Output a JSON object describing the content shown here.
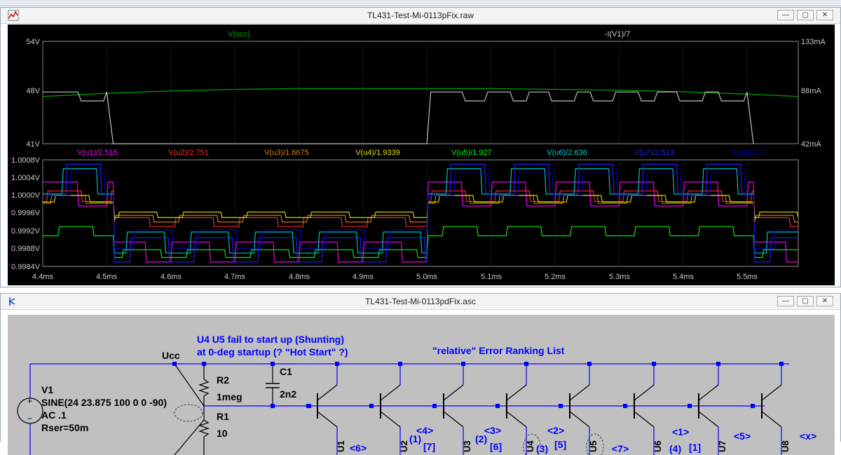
{
  "waveform_window": {
    "title": "TL431-Test-Mi-0113pFix.raw",
    "controls": {
      "minimize": "—",
      "maximize": "▢",
      "close": "✕"
    }
  },
  "schematic_window": {
    "title": "TL431-Test-Mi-0113pdFix.asc",
    "controls": {
      "minimize": "—",
      "maximize": "▢",
      "close": "✕"
    }
  },
  "chart_data": [
    {
      "type": "line",
      "title": "",
      "left_trace_label": "V(ucc)",
      "right_trace_label": "-I(V1)/7",
      "left_axis_ticks": [
        "54V",
        "48V",
        "41V"
      ],
      "right_axis_ticks": [
        "133mA",
        "88mA",
        "42mA"
      ],
      "ylim_left": [
        41,
        54
      ],
      "ylim_right": [
        42,
        133
      ],
      "xlim_ms": [
        4.4,
        5.58
      ],
      "series": [
        {
          "name": "V(ucc)",
          "color": "#00a000",
          "x": [
            4.4,
            4.5,
            4.6,
            4.7,
            4.8,
            4.9,
            5.0,
            5.1,
            5.2,
            5.3,
            5.4,
            5.5,
            5.58
          ],
          "y": [
            47.0,
            47.4,
            47.7,
            47.9,
            48.0,
            48.0,
            48.0,
            48.0,
            47.9,
            47.8,
            47.6,
            47.3,
            47.0
          ]
        },
        {
          "name": "-I(V1)/7",
          "color": "#c0c0c0",
          "x": [
            4.4,
            4.455,
            4.46,
            4.495,
            4.5,
            4.51,
            5.0,
            5.006,
            5.055,
            5.06,
            5.09,
            5.095,
            5.13,
            5.135,
            5.155,
            5.16,
            5.19,
            5.195,
            5.23,
            5.235,
            5.255,
            5.26,
            5.29,
            5.295,
            5.33,
            5.335,
            5.355,
            5.36,
            5.39,
            5.395,
            5.43,
            5.435,
            5.455,
            5.46,
            5.495,
            5.5,
            5.51
          ],
          "y": [
            88,
            88,
            80,
            80,
            88,
            42,
            42,
            88,
            88,
            80,
            80,
            88,
            88,
            80,
            80,
            88,
            88,
            80,
            80,
            88,
            88,
            80,
            80,
            88,
            88,
            80,
            80,
            88,
            88,
            80,
            80,
            88,
            88,
            80,
            80,
            88,
            42
          ]
        }
      ]
    },
    {
      "type": "line",
      "title": "",
      "y_axis_ticks": [
        "1.0008V",
        "1.0004V",
        "1.0000V",
        "0.9996V",
        "0.9992V",
        "0.9988V",
        "0.9984V"
      ],
      "ylim": [
        0.9984,
        1.0008
      ],
      "x_axis_ticks": [
        "4.4ms",
        "4.5ms",
        "4.6ms",
        "4.7ms",
        "4.8ms",
        "4.9ms",
        "5.0ms",
        "5.1ms",
        "5.2ms",
        "5.3ms",
        "5.4ms",
        "5.5ms"
      ],
      "xlim_ms": [
        4.4,
        5.58
      ],
      "series": [
        {
          "name": "V(u1)/2.515",
          "color": "#ff00ff",
          "high": 1.0003,
          "low": 0.9985
        },
        {
          "name": "V(u2)/2.751",
          "color": "#ff3030",
          "high": 1.0001,
          "low": 0.9993
        },
        {
          "name": "V(u3)/1.6675",
          "color": "#e08000",
          "high": 1.0,
          "low": 0.9994
        },
        {
          "name": "V(u4)/1.9339",
          "color": "#e0e000",
          "high": 1.0,
          "low": 0.9995
        },
        {
          "name": "V(u5)/1.927",
          "color": "#00ff00",
          "high": 0.9993,
          "low": 0.9986
        },
        {
          "name": "V(u6)/2.636",
          "color": "#00d0d0",
          "high": 1.0006,
          "low": 0.9987
        },
        {
          "name": "V(u7)/2.513",
          "color": "#2020ff",
          "high": 1.0007,
          "low": 0.9985
        },
        {
          "name": "V(u8)/2.5",
          "color": "#0000c0",
          "high": 1.0005,
          "low": 0.9988
        }
      ],
      "active_intervals_ms": [
        [
          4.4,
          4.51
        ],
        [
          5.0,
          5.51
        ]
      ],
      "toggle_period_ms": 0.1
    }
  ],
  "schematic": {
    "notes": [
      "U4 U5 fail to start up (Shunting)",
      "at 0-deg startup (? \"Hot Start\" ?)",
      "\"relative\" Error Ranking List"
    ],
    "labels": {
      "ucc": "Ucc",
      "v1": "V1",
      "v1_value": "SINE(24 23.875 100 0 0 -90)",
      "v1_ac": "AC .1",
      "v1_rser": "Rser=50m",
      "r2": "R2",
      "r2_value": "1meg",
      "r1": "R1",
      "r1_value": "10",
      "c1": "C1",
      "c1_value": "2n2",
      "plus": "+",
      "minus": "−"
    },
    "transistor_labels": [
      "U1",
      "U2",
      "U3",
      "U4",
      "U5",
      "U6",
      "U7",
      "U8"
    ],
    "ranking_marks": [
      "<6>",
      "(1)",
      "[7]",
      "<4>",
      "(2)",
      "[6]",
      "<3>",
      "(3)",
      "[5]",
      "<2>",
      "<7>",
      "(4)",
      "<1>",
      "[1]",
      "<5>",
      "<x>"
    ],
    "colors": {
      "wire": "#0000ff",
      "junction": "#0000ff",
      "note_text": "#0000ff",
      "component": "#000000"
    }
  }
}
